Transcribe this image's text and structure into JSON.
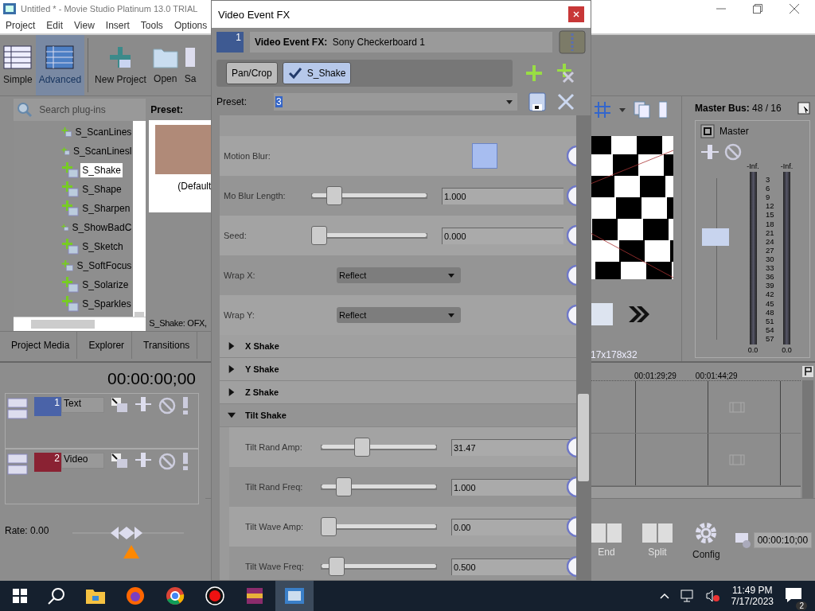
{
  "app": {
    "title": "Untitled * - Movie Studio Platinum 13.0 TRIAL",
    "menu": [
      "Project",
      "Edit",
      "View",
      "Insert",
      "Tools",
      "Options"
    ]
  },
  "toolbar": [
    {
      "label": "Simple",
      "kind": "simple",
      "selected": false
    },
    {
      "label": "Advanced",
      "kind": "advanced",
      "selected": true
    },
    {
      "label": "New Project",
      "kind": "new",
      "selected": false
    },
    {
      "label": "Open",
      "kind": "open",
      "selected": false
    },
    {
      "label": "Sa",
      "kind": "save",
      "selected": false
    }
  ],
  "plugins": {
    "search_placeholder": "Search plug-ins",
    "items": [
      {
        "label": "S_ScanLines",
        "selected": false
      },
      {
        "label": "S_ScanLinesl",
        "selected": false
      },
      {
        "label": "S_Shake",
        "selected": true
      },
      {
        "label": "S_Shape",
        "selected": false
      },
      {
        "label": "S_Sharpen",
        "selected": false
      },
      {
        "label": "S_ShowBadC",
        "selected": false
      },
      {
        "label": "S_Sketch",
        "selected": false
      },
      {
        "label": "S_SoftFocus",
        "selected": false
      },
      {
        "label": "S_Solarize",
        "selected": false
      },
      {
        "label": "S_Sparkles",
        "selected": false
      }
    ]
  },
  "preset_panel": {
    "title": "Preset:",
    "caption": "(Default",
    "status": "S_Shake: OFX,"
  },
  "tabs": [
    {
      "label": "Project Media",
      "selected": false
    },
    {
      "label": "Explorer",
      "selected": false
    },
    {
      "label": "Transitions",
      "selected": false
    }
  ],
  "preview": {
    "resolution": "17x178x32"
  },
  "mixer": {
    "title": "Master Bus:",
    "value": "48 / 16",
    "channel": "Master",
    "peaks": [
      "-Inf.",
      "-Inf."
    ],
    "scale": [
      "3",
      "6",
      "9",
      "12",
      "15",
      "18",
      "21",
      "24",
      "27",
      "30",
      "33",
      "36",
      "39",
      "42",
      "45",
      "48",
      "51",
      "54",
      "57"
    ],
    "readings": [
      "0.0",
      "0.0"
    ],
    "fader": {
      "level": 0.65
    }
  },
  "timeline": {
    "timecode": "00:00:00;00",
    "tracks": [
      {
        "number": "1",
        "name": "Text",
        "kind": "text"
      },
      {
        "number": "2",
        "name": "Video",
        "kind": "video"
      }
    ],
    "ruler": [
      "00:01:29;29",
      "00:01:44;29"
    ],
    "rate": "Rate: 0.00"
  },
  "edit_toolbar": [
    {
      "label": "End",
      "disabled": true
    },
    {
      "label": "Split",
      "disabled": true
    },
    {
      "label": "Config",
      "disabled": false
    }
  ],
  "end_time": "00:00:10;00",
  "dialog": {
    "title": "Video Event FX",
    "track_number": "1",
    "header_label": "Video Event FX:",
    "header_value": "Sony Checkerboard 1",
    "chain": [
      {
        "label": "Pan/Crop",
        "selected": false,
        "checked": false
      },
      {
        "label": "S_Shake",
        "selected": true,
        "checked": true
      }
    ],
    "preset_label": "Preset:",
    "preset_value": "3",
    "params": [
      {
        "kind": "checkbox",
        "label": "Motion Blur:",
        "checked": false
      },
      {
        "kind": "slider",
        "label": "Mo Blur Length:",
        "level": 0.15,
        "value": "1.000"
      },
      {
        "kind": "slider",
        "label": "Seed:",
        "level": 0,
        "value": "0.000"
      },
      {
        "kind": "dropdown",
        "label": "Wrap X:",
        "value": "Reflect"
      },
      {
        "kind": "dropdown",
        "label": "Wrap Y:",
        "value": "Reflect"
      }
    ],
    "groups": [
      {
        "label": "X Shake",
        "expanded": false
      },
      {
        "label": "Y Shake",
        "expanded": false
      },
      {
        "label": "Z Shake",
        "expanded": false
      },
      {
        "label": "Tilt Shake",
        "expanded": true,
        "params": [
          {
            "kind": "slider",
            "label": "Tilt Rand Amp:",
            "level": 0.33,
            "value": "31.47"
          },
          {
            "kind": "slider",
            "label": "Tilt Rand Freq:",
            "level": 0.15,
            "value": "1.000"
          },
          {
            "kind": "slider",
            "label": "Tilt Wave Amp:",
            "level": 0,
            "value": "0.00"
          },
          {
            "kind": "slider",
            "label": "Tilt Wave Freq:",
            "level": 0.08,
            "value": "0.500"
          }
        ]
      }
    ]
  },
  "taskbar": {
    "time": "11:49 PM",
    "date": "7/17/2023",
    "notifications": "2"
  }
}
